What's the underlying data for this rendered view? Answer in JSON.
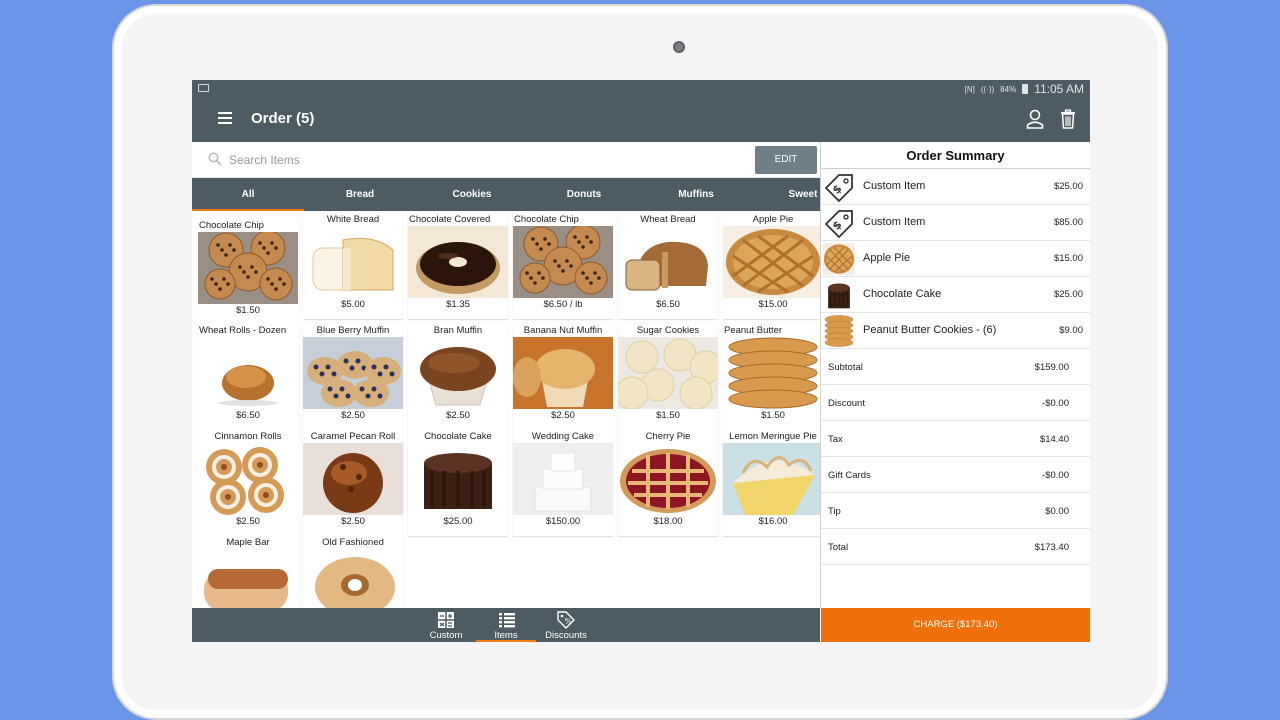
{
  "statusbar": {
    "battery": "84%",
    "time": "11:05 AM"
  },
  "appbar": {
    "title": "Order (5)"
  },
  "search": {
    "placeholder": "Search Items",
    "edit_label": "EDIT"
  },
  "categories": [
    "All",
    "Bread",
    "Cookies",
    "Donuts",
    "Muffins",
    "Sweet R"
  ],
  "items": [
    {
      "name": "Chocolate Chip",
      "price": "$1.50",
      "kind": "cookie"
    },
    {
      "name": "White Bread",
      "price": "$5.00",
      "kind": "whitebread"
    },
    {
      "name": "Chocolate Covered",
      "price": "$1.35",
      "kind": "chocdonut"
    },
    {
      "name": "Chocolate Chip",
      "price": "$6.50 / lb",
      "kind": "cookie"
    },
    {
      "name": "Wheat Bread",
      "price": "$6.50",
      "kind": "wheatbread"
    },
    {
      "name": "Apple Pie",
      "price": "$15.00",
      "kind": "applepie"
    },
    {
      "name": "Wheat Rolls - Dozen",
      "price": "$6.50",
      "kind": "roll"
    },
    {
      "name": "Blue Berry Muffin",
      "price": "$2.50",
      "kind": "blueberry"
    },
    {
      "name": "Bran Muffin",
      "price": "$2.50",
      "kind": "bran"
    },
    {
      "name": "Banana Nut Muffin",
      "price": "$2.50",
      "kind": "banana"
    },
    {
      "name": "Sugar Cookies",
      "price": "$1.50",
      "kind": "sugar"
    },
    {
      "name": "Peanut Butter",
      "price": "$1.50",
      "kind": "peanut"
    },
    {
      "name": "Cinnamon Rolls",
      "price": "$2.50",
      "kind": "cinnamon"
    },
    {
      "name": "Caramel Pecan Roll",
      "price": "$2.50",
      "kind": "caramel"
    },
    {
      "name": "Chocolate Cake",
      "price": "$25.00",
      "kind": "choccake"
    },
    {
      "name": "Wedding Cake",
      "price": "$150.00",
      "kind": "wedding"
    },
    {
      "name": "Cherry Pie",
      "price": "$18.00",
      "kind": "cherry"
    },
    {
      "name": "Lemon Meringue Pie",
      "price": "$16.00",
      "kind": "lemon"
    },
    {
      "name": "Maple Bar",
      "price": "",
      "kind": "maple"
    },
    {
      "name": "Old Fashioned",
      "price": "",
      "kind": "oldfashioned"
    }
  ],
  "bottom_nav": [
    "Custom",
    "Items",
    "Discounts"
  ],
  "summary": {
    "title": "Order Summary",
    "lines": [
      {
        "name": "Custom Item",
        "amount": "$25.00",
        "thumb": "tag"
      },
      {
        "name": "Custom Item",
        "amount": "$85.00",
        "thumb": "tag"
      },
      {
        "name": "Apple Pie",
        "amount": "$15.00",
        "thumb": "applepie"
      },
      {
        "name": "Chocolate Cake",
        "amount": "$25.00",
        "thumb": "choccake"
      },
      {
        "name": "Peanut Butter Cookies - (6)",
        "amount": "$9.00",
        "thumb": "peanut"
      }
    ],
    "totals": [
      {
        "label": "Subtotal",
        "value": "$159.00"
      },
      {
        "label": "Discount",
        "value": "-$0.00"
      },
      {
        "label": "Tax",
        "value": "$14.40"
      },
      {
        "label": "Gift Cards",
        "value": "-$0.00"
      },
      {
        "label": "Tip",
        "value": "$0.00"
      },
      {
        "label": "Total",
        "value": "$173.40"
      }
    ]
  },
  "charge_label": "CHARGE ($173.40)",
  "colors": {
    "appbar": "#4d5b63",
    "accent": "#ef6f0a",
    "page_bg": "#6a94e8"
  }
}
